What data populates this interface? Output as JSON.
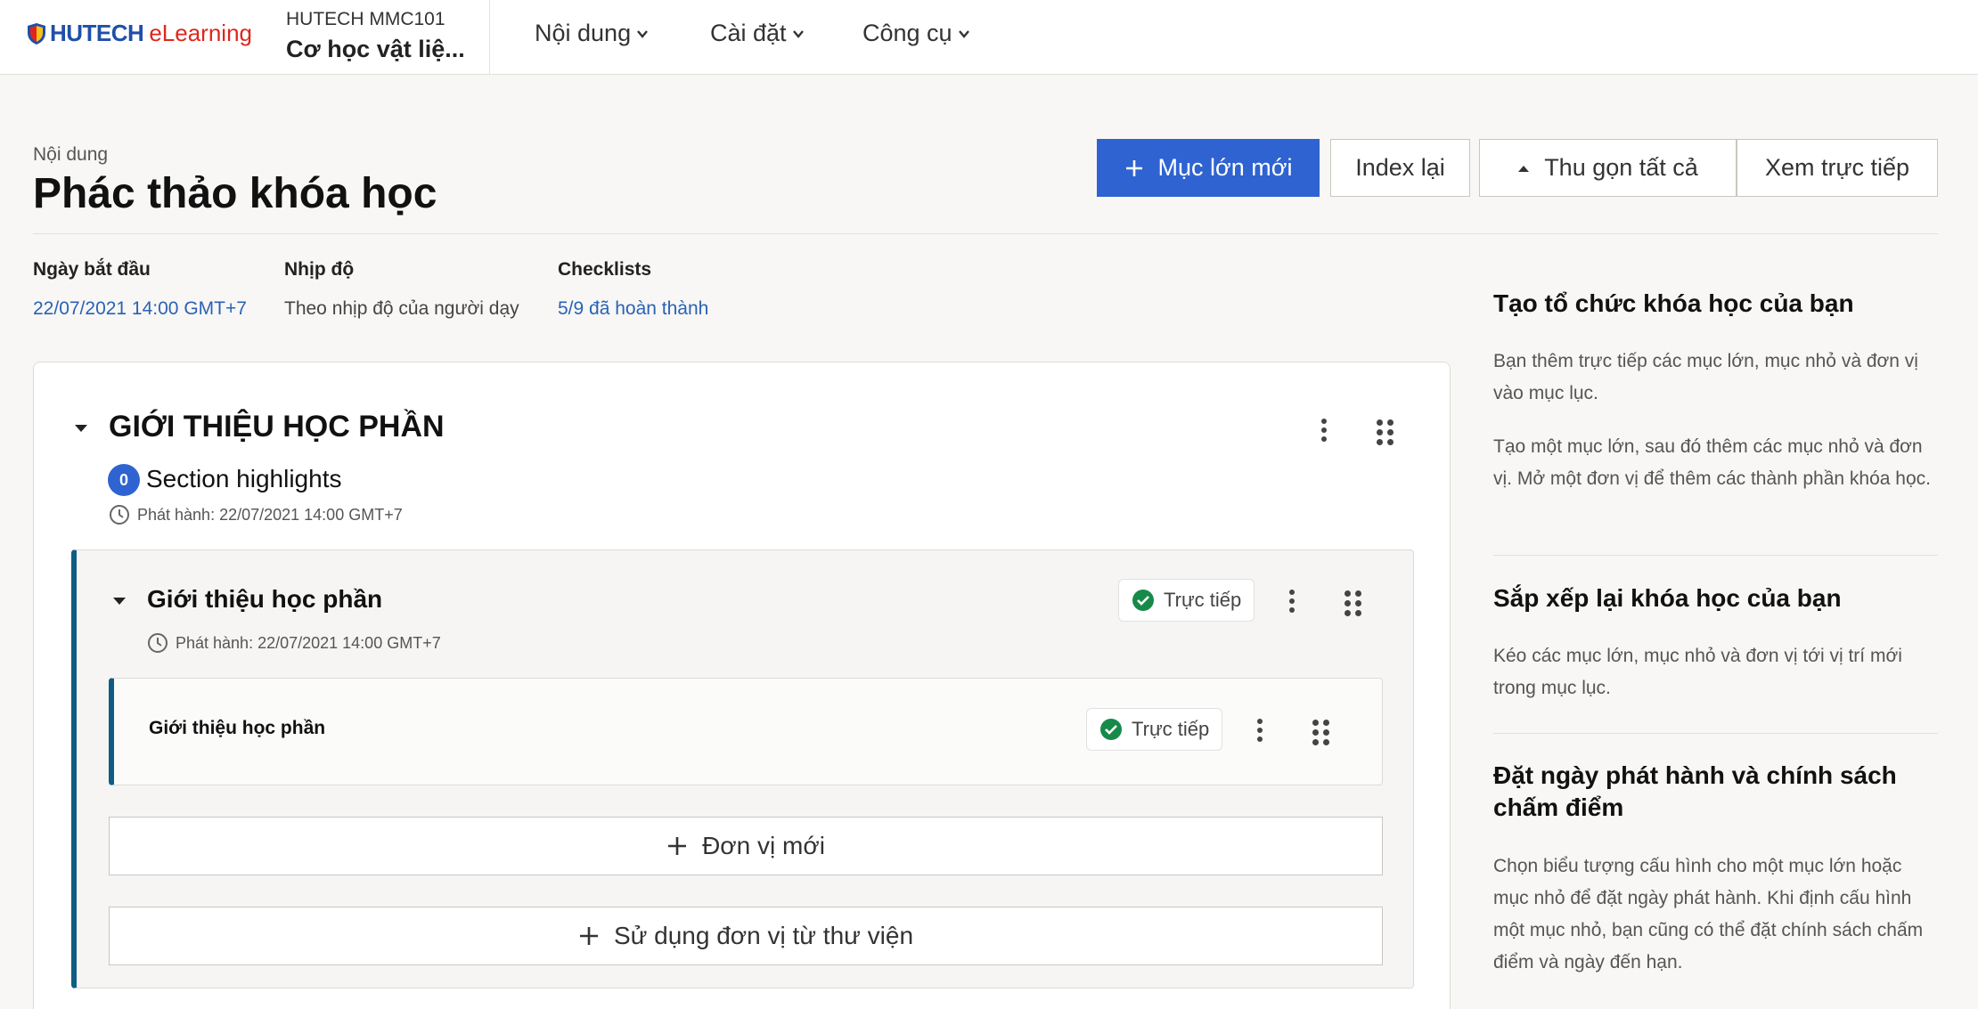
{
  "header": {
    "logo_brand": "HUTECH",
    "logo_suffix": "eLearning",
    "course_id": "HUTECH MMC101",
    "course_name": "Cơ học vật liệ...",
    "nav": [
      {
        "label": "Nội dung"
      },
      {
        "label": "Cài đặt"
      },
      {
        "label": "Công cụ"
      }
    ]
  },
  "page": {
    "subtitle": "Nội dung",
    "title": "Phác thảo khóa học",
    "buttons": {
      "new_section": "Mục lớn mới",
      "reindex": "Index lại",
      "collapse_all": "Thu gọn tất cả",
      "view_live": "Xem trực tiếp"
    },
    "colors": {
      "primary": "#2e63d1",
      "accent_border": "#0f5c85",
      "link": "#2a62b5",
      "success": "#178a4a"
    }
  },
  "info": {
    "start_label": "Ngày bắt đầu",
    "start_value": "22/07/2021 14:00 GMT+7",
    "pace_label": "Nhịp độ",
    "pace_value": "Theo nhịp độ của người dạy",
    "checklist_label": "Checklists",
    "checklist_value": "5/9 đã hoàn thành"
  },
  "section": {
    "title": "GIỚI THIỆU HỌC PHẦN",
    "highlights_count": "0",
    "highlights_label": "Section highlights",
    "release": "Phát hành: 22/07/2021 14:00 GMT+7",
    "subsection": {
      "title": "Giới thiệu học phần",
      "status": "Trực tiếp",
      "release": "Phát hành: 22/07/2021 14:00 GMT+7",
      "unit": {
        "title": "Giới thiệu học phần",
        "status": "Trực tiếp"
      },
      "new_unit": "Đơn vị mới",
      "library_unit": "Sử dụng đơn vị từ thư viện"
    }
  },
  "sidebar": {
    "blocks": [
      {
        "heading": "Tạo tổ chức khóa học của bạn",
        "paragraphs": [
          "Bạn thêm trực tiếp các mục lớn, mục nhỏ và đơn vị vào mục lục.",
          "Tạo một mục lớn, sau đó thêm các mục nhỏ và đơn vị. Mở một đơn vị để thêm các thành phần khóa học."
        ]
      },
      {
        "heading": "Sắp xếp lại khóa học của bạn",
        "paragraphs": [
          "Kéo các mục lớn, mục nhỏ và đơn vị tới vị trí mới trong mục lục."
        ]
      },
      {
        "heading": "Đặt ngày phát hành và chính sách chấm điểm",
        "paragraphs": [
          "Chọn biểu tượng cấu hình cho một mục lớn hoặc mục nhỏ để đặt ngày phát hành. Khi định cấu hình một mục nhỏ, bạn cũng có thể đặt chính sách chấm điểm và ngày đến hạn."
        ]
      }
    ]
  }
}
